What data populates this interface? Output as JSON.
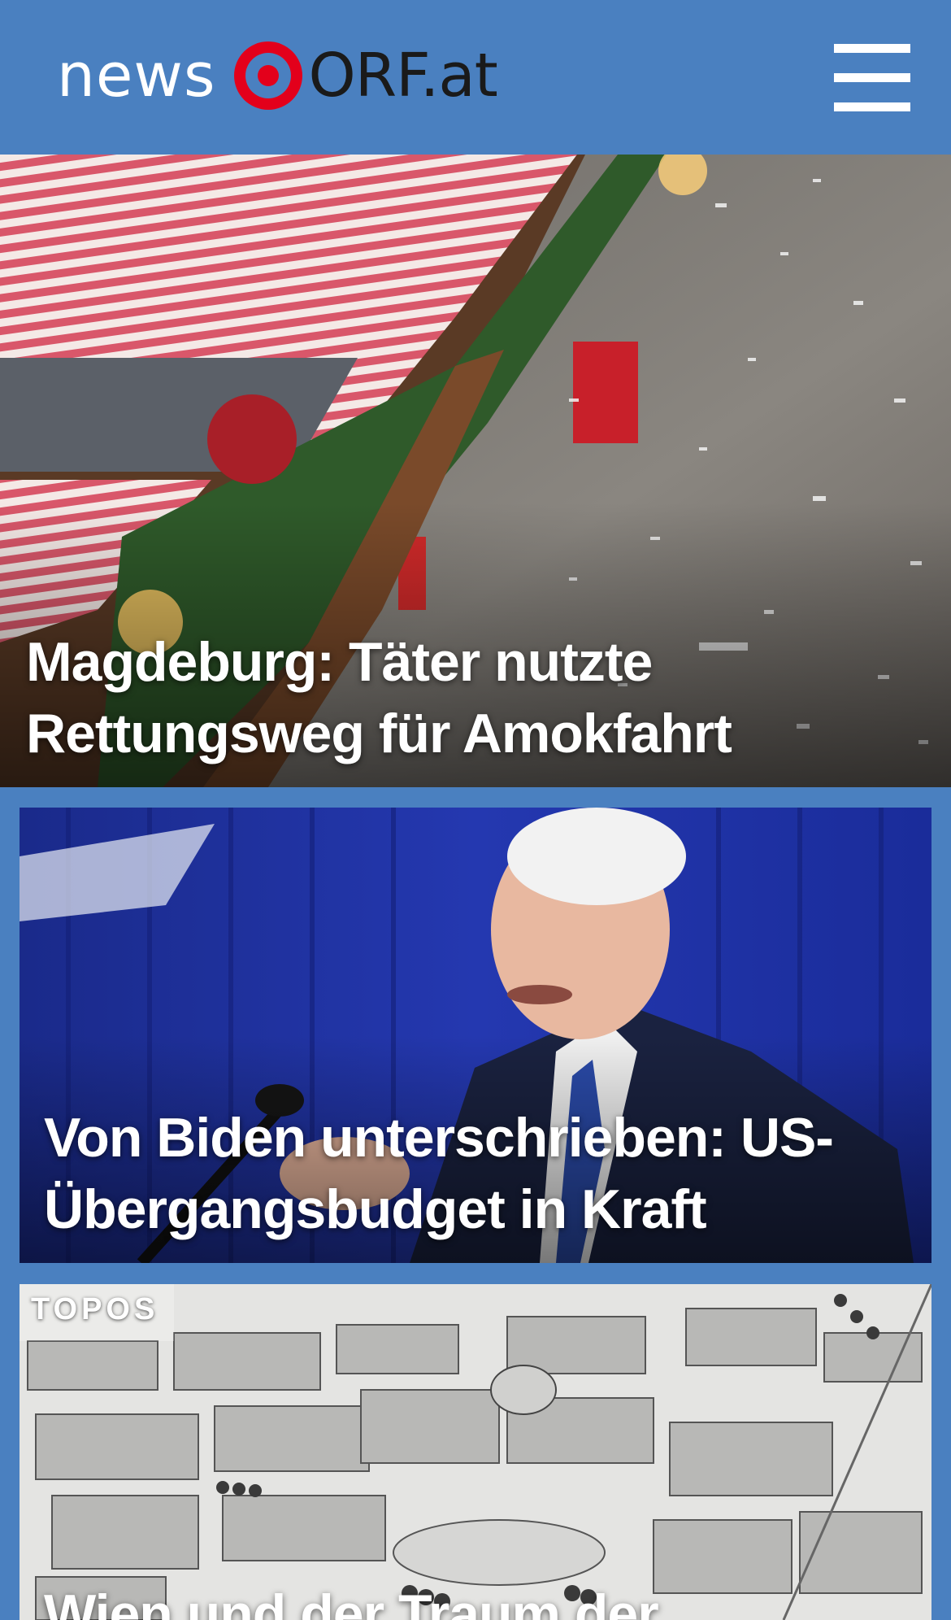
{
  "header": {
    "logo_news": "news",
    "logo_orf": "ORF.at",
    "menu_icon": "hamburger-menu-icon"
  },
  "stories": [
    {
      "kicker": "",
      "headline": "Magdeburg: Täter nutzte Rettungsweg für Amokfahrt"
    },
    {
      "kicker": "",
      "headline": "Von Biden unterschrieben: US-Übergangsbudget in Kraft"
    },
    {
      "kicker": "TOPOS",
      "headline": "Wien und der Traum der"
    }
  ],
  "colors": {
    "header_bg": "#4a80c0",
    "brand_red": "#e3001b",
    "logo_dark": "#1a1a1a"
  }
}
